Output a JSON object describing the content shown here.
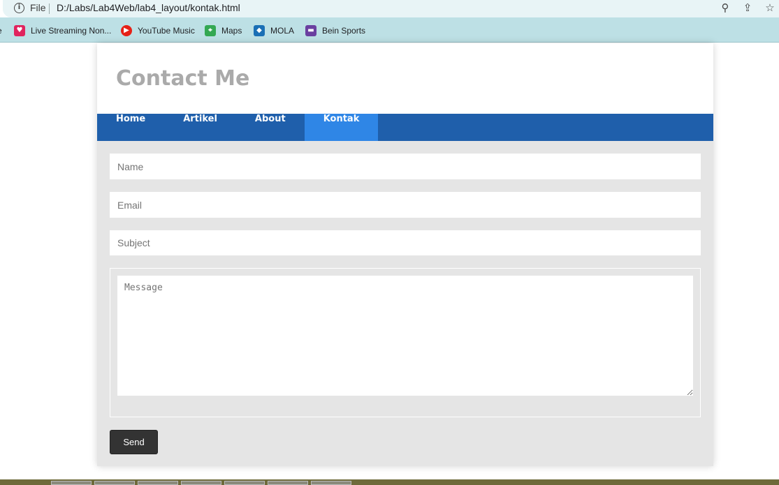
{
  "browser": {
    "file_label": "File",
    "url": "D:/Labs/Lab4Web/lab4_layout/kontak.html",
    "bookmarks": [
      {
        "label": "Live Streaming Non...",
        "icon": "heart-icon",
        "color": "#e0245e"
      },
      {
        "label": "YouTube Music",
        "icon": "youtube-music-icon",
        "color": "#e62117"
      },
      {
        "label": "Maps",
        "icon": "maps-icon",
        "color": "#34a853"
      },
      {
        "label": "MOLA",
        "icon": "mola-icon",
        "color": "#1a6fb5"
      },
      {
        "label": "Bein Sports",
        "icon": "bein-icon",
        "color": "#6a3fa0"
      }
    ]
  },
  "page": {
    "title": "Contact Me",
    "nav": [
      {
        "label": "Home"
      },
      {
        "label": "Artikel"
      },
      {
        "label": "About"
      },
      {
        "label": "Kontak",
        "active": true
      }
    ],
    "form": {
      "name_placeholder": "Name",
      "email_placeholder": "Email",
      "subject_placeholder": "Subject",
      "message_placeholder": "Message",
      "send_label": "Send"
    }
  },
  "colors": {
    "nav_bg": "#1f5fab",
    "nav_active": "#2f86e6",
    "content_bg": "#e5e5e5",
    "send_bg": "#333333"
  }
}
